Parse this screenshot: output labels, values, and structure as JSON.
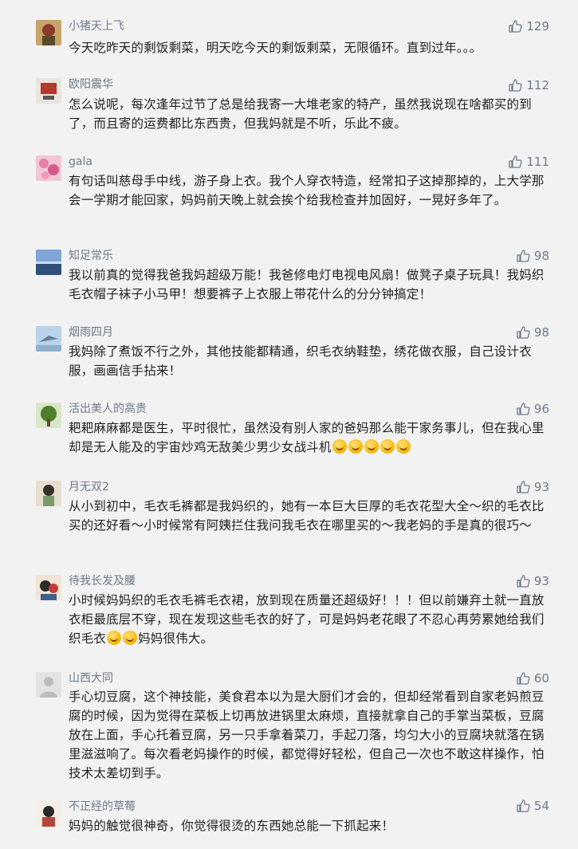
{
  "comments": [
    {
      "username": "小猪天上飞",
      "likes": "129",
      "text": "今天吃昨天的剩饭剩菜，明天吃今天的剩饭剩菜，无限循环。直到过年。。。"
    },
    {
      "username": "欧阳震华",
      "likes": "112",
      "text": "怎么说呢，每次逢年过节了总是给我寄一大堆老家的特产，虽然我说现在啥都买的到了，而且寄的运费都比东西贵，但我妈就是不听，乐此不疲。"
    },
    {
      "username": "gala",
      "likes": "111",
      "text": "有句话叫慈母手中线，游子身上衣。我个人穿衣特造，经常扣子这掉那掉的，上大学那会一学期才能回家，妈妈前天晚上就会挨个给我检查并加固好，一晃好多年了。"
    },
    {
      "username": "知足常乐",
      "likes": "98",
      "text": "我以前真的觉得我爸我妈超级万能！我爸修电灯电视电风扇！做凳子桌子玩具！我妈织毛衣帽子袜子小马甲！想要裤子上衣服上带花什么的分分钟搞定！"
    },
    {
      "username": "烟雨四月",
      "likes": "98",
      "text": "我妈除了煮饭不行之外，其他技能都精通，织毛衣纳鞋垫，绣花做衣服，自己设计衣服，画画信手拈来！"
    },
    {
      "username": "活出美人的高贵",
      "likes": "96",
      "text": "耙耙麻麻都是医生，平时很忙，虽然没有别人家的爸妈那么能干家务事儿，但在我心里却是无人能及的宇宙炒鸡无敌美少男少女战斗机"
    },
    {
      "username": "月无双2",
      "likes": "93",
      "text": "从小到初中，毛衣毛裤都是我妈织的，她有一本巨大巨厚的毛衣花型大全～织的毛衣比买的还好看～小时候常有阿姨拦住我问我毛衣在哪里买的～我老妈的手是真的很巧～"
    },
    {
      "username": "待我长发及腰",
      "likes": "93",
      "text_a": "小时候妈妈织的毛衣毛裤毛衣裙，放到现在质量还超级好！！！但以前嫌弃土就一直放衣柜最底层不穿，现在发现这些毛衣的好了，可是妈妈老花眼了不忍心再劳累她给我们织毛衣",
      "text_b": "妈妈很伟大。"
    },
    {
      "username": "山西大同",
      "likes": "60",
      "text": "手心切豆腐，这个神技能，美食君本以为是大厨们才会的，但却经常看到自家老妈煎豆腐的时候，因为觉得在菜板上切再放进锅里太麻烦，直接就拿自己的手掌当菜板，豆腐放在上面，手心托着豆腐，另一只手拿着菜刀，手起刀落，均匀大小的豆腐块就落在锅里滋滋响了。每次看老妈操作的时候，都觉得好轻松，但自己一次也不敢这样操作，怕技术太差切到手。"
    },
    {
      "username": "不正经的草莓",
      "likes": "54",
      "text": "妈妈的触觉很神奇，你觉得很烫的东西她总能一下抓起来！"
    }
  ],
  "colors": {
    "background": "#f2f2f2",
    "username": "#6e7a89",
    "text": "#222222"
  },
  "icons": {
    "like": "thumbs-up-icon",
    "emoji": "emoji-icon"
  }
}
